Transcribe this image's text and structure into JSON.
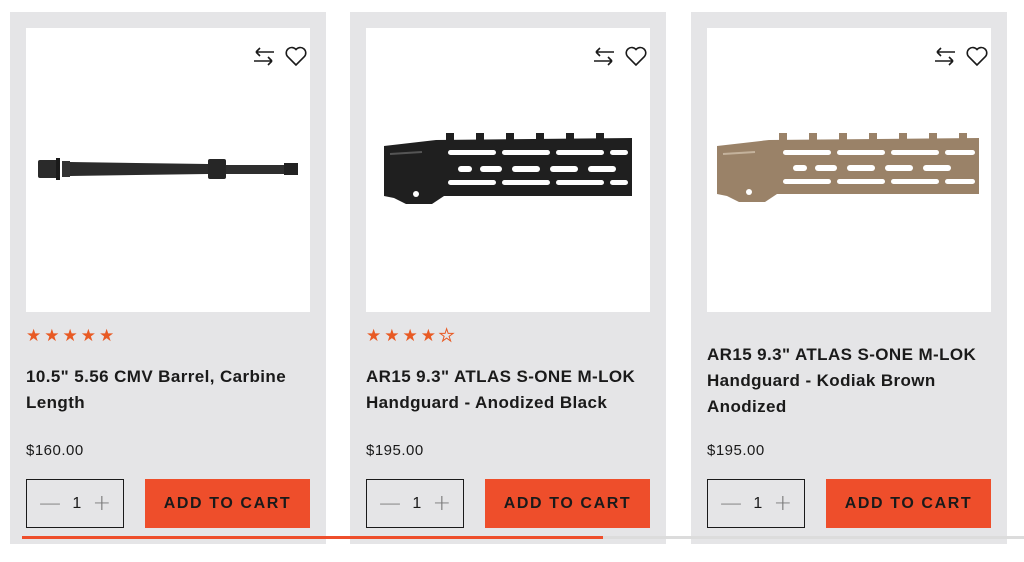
{
  "products": [
    {
      "name": "10.5\" 5.56 CMV Barrel, Carbine Length",
      "price": "$160.00",
      "rating": 5,
      "stars": "★★★★★",
      "quantity": "1",
      "add_to_cart_label": "ADD TO CART",
      "image": "barrel"
    },
    {
      "name": "AR15 9.3\" ATLAS S-ONE M-LOK Handguard - Anodized Black",
      "price": "$195.00",
      "rating": 4.5,
      "stars": "★★★★",
      "quantity": "1",
      "add_to_cart_label": "ADD TO CART",
      "image": "handguard-black"
    },
    {
      "name": "AR15 9.3\" ATLAS S-ONE M-LOK Handguard - Kodiak Brown Anodized",
      "price": "$195.00",
      "quantity": "1",
      "add_to_cart_label": "ADD TO CART",
      "image": "handguard-brown"
    }
  ],
  "icons": {
    "compare": "compare-arrows-icon",
    "wishlist": "heart-outline-icon",
    "qty_minus": "minus-icon",
    "qty_plus": "plus-icon"
  },
  "colors": {
    "accent": "#ee4e2b",
    "star": "#e85a24",
    "card_bg": "#e5e5e7",
    "handguard_black": "#1f1f1f",
    "handguard_brown": "#9a8268"
  },
  "carousel_progress": 0.58
}
